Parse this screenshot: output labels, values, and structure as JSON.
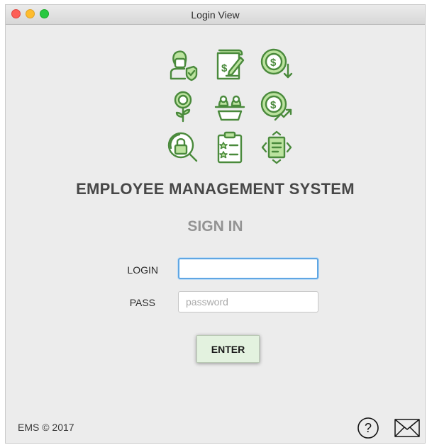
{
  "window": {
    "title": "Login View"
  },
  "icons": [
    "employee-shield-icon",
    "invoice-edit-icon",
    "coin-down-icon",
    "money-plant-icon",
    "team-meeting-icon",
    "coin-growth-icon",
    "search-lock-icon",
    "clipboard-rating-icon",
    "document-arrows-icon"
  ],
  "app": {
    "heading": "EMPLOYEE MANAGEMENT SYSTEM",
    "subheading": "SIGN IN"
  },
  "form": {
    "login_label": "LOGIN",
    "login_value": "",
    "pass_label": "PASS",
    "pass_placeholder": "password",
    "enter_label": "ENTER"
  },
  "footer": {
    "copyright": "EMS © 2017"
  },
  "colors": {
    "icon_stroke": "#4a8a3c",
    "icon_fill": "#bce39f",
    "accent_focus": "#5fa6e3",
    "button_bg": "#e3f2df"
  }
}
